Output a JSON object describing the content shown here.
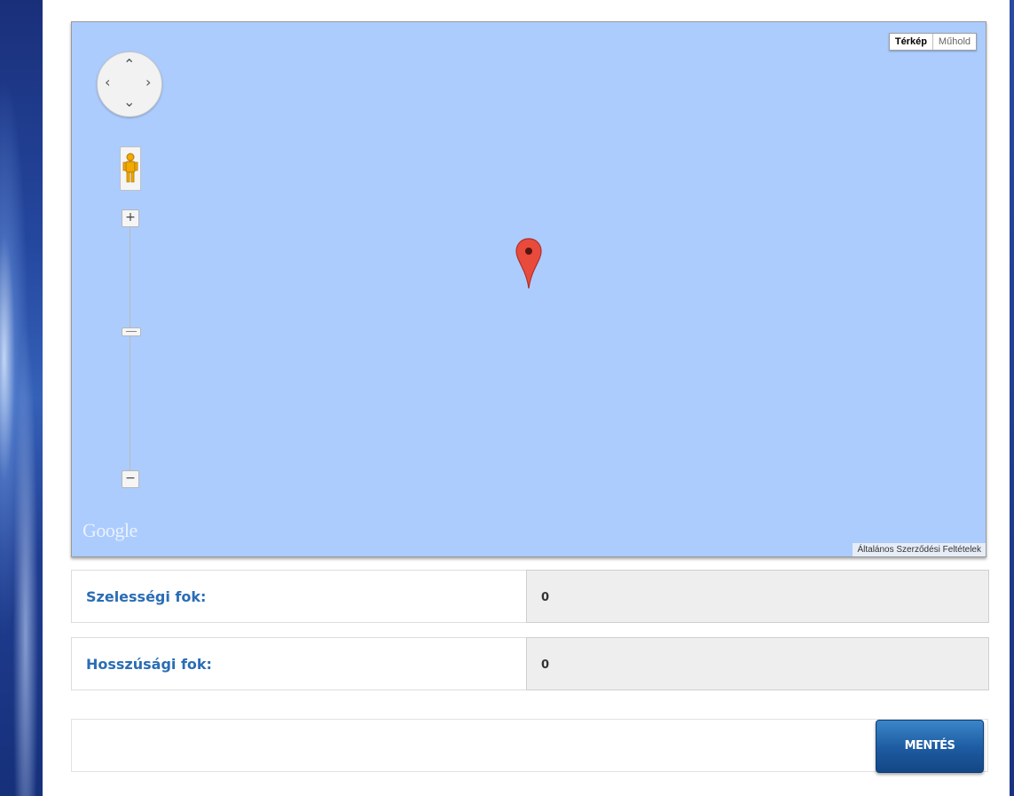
{
  "map": {
    "type_buttons": [
      {
        "label": "Térkép",
        "active": true
      },
      {
        "label": "Műhold",
        "active": false
      }
    ],
    "logo": "Google",
    "terms_link": "Általános Szerződési Feltételek",
    "zoom_in": "+",
    "zoom_out": "−",
    "water_color": "#acccfe",
    "marker_color": "#e84b3c"
  },
  "form": {
    "latitude_label": "Szelességi fok:",
    "latitude_value": "0",
    "longitude_label": "Hosszúsági fok:",
    "longitude_value": "0",
    "save_label": "MENTÉS",
    "label_color": "#2a6db5",
    "button_color": "#1d5aa0"
  }
}
